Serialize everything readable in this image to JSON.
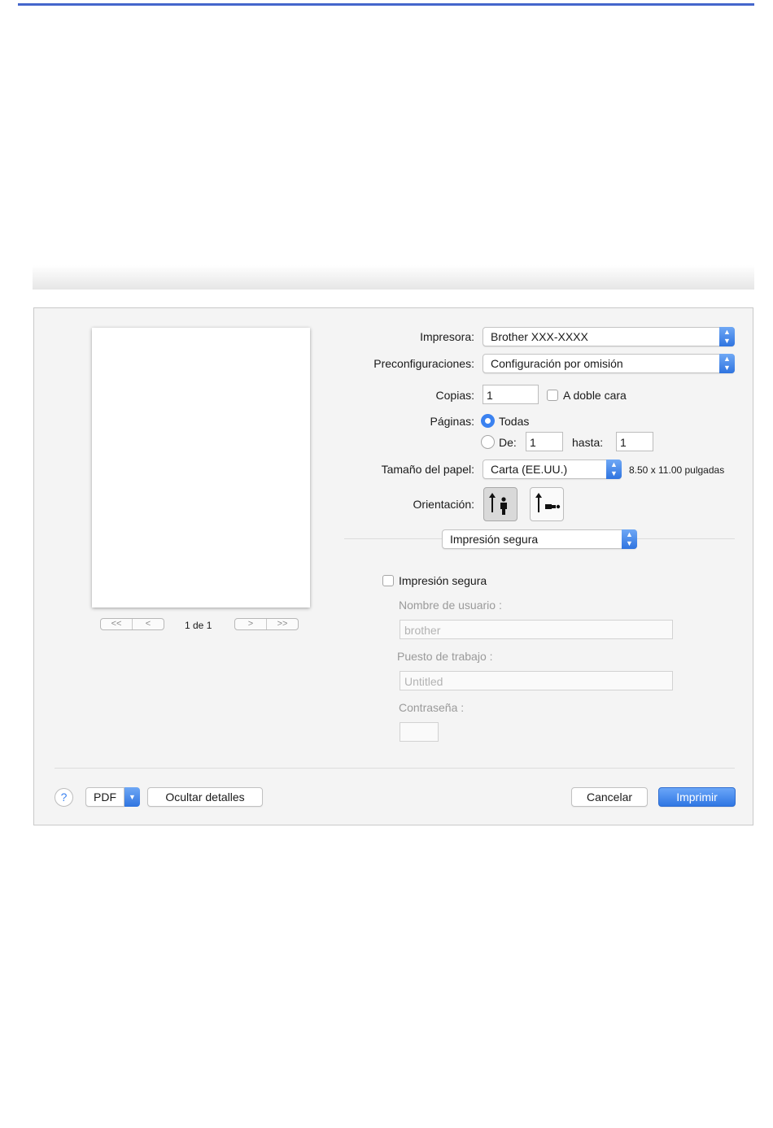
{
  "dialog": {
    "preview": {
      "page_indicator": "1 de 1",
      "nav_first": "<<",
      "nav_prev": "<",
      "nav_next": ">",
      "nav_last": ">>"
    },
    "printer": {
      "label": "Impresora:",
      "value": "Brother XXX-XXXX"
    },
    "presets": {
      "label": "Preconfiguraciones:",
      "value": "Configuración por omisión"
    },
    "copies": {
      "label": "Copias:",
      "value": "1",
      "duplex_label": "A doble cara",
      "duplex_checked": false
    },
    "pages": {
      "label": "Páginas:",
      "all_label": "Todas",
      "all_selected": true,
      "range_label": "De:",
      "from": "1",
      "to_label": "hasta:",
      "to": "1"
    },
    "paper_size": {
      "label": "Tamaño del papel:",
      "value": "Carta (EE.UU.)",
      "dimensions": "8.50 x 11.00 pulgadas"
    },
    "orientation": {
      "label": "Orientación:",
      "selected": "portrait"
    },
    "section": {
      "value": "Impresión segura"
    },
    "secure_print": {
      "checkbox_label": "Impresión segura",
      "checked": false,
      "user_label": "Nombre de usuario :",
      "user_value": "brother",
      "job_label": "Puesto de trabajo :",
      "job_value": "Untitled",
      "password_label": "Contraseña :",
      "password_value": ""
    },
    "footer": {
      "help": "?",
      "pdf": "PDF",
      "hide_details": "Ocultar detalles",
      "cancel": "Cancelar",
      "print": "Imprimir"
    }
  },
  "colors": {
    "accent": "#3b82f0",
    "top_rule": "#4466cc"
  }
}
